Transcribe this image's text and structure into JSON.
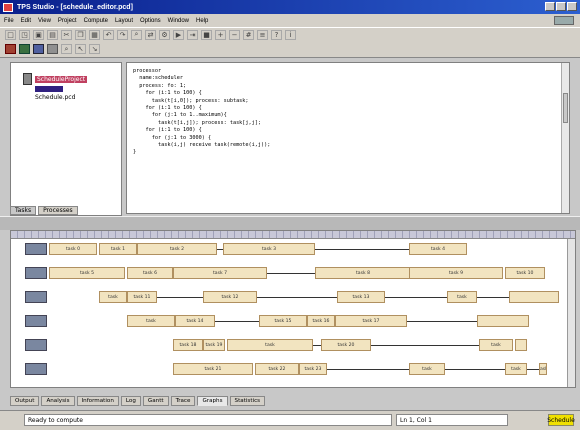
{
  "window": {
    "title": "TPS Studio - [schedule_editor.pcd]"
  },
  "menu": [
    "File",
    "Edit",
    "View",
    "Project",
    "Compute",
    "Layout",
    "Options",
    "Window",
    "Help"
  ],
  "toolbar1_icons": [
    "new-icon",
    "open-icon",
    "save-icon",
    "print-icon",
    "cut-icon",
    "copy-icon",
    "paste-icon",
    "undo-icon",
    "redo-icon",
    "find-icon",
    "replace-icon",
    "compile-icon",
    "run-icon",
    "step-icon",
    "stop-icon",
    "zoom-in-icon",
    "zoom-out-icon",
    "grid-icon",
    "settings-icon",
    "help-icon",
    "about-icon"
  ],
  "toolbar2_icons": [
    "process-icon",
    "channel-icon",
    "task-icon",
    "graph-icon",
    "zoom-icon",
    "pointer-icon",
    "link-icon"
  ],
  "tree": {
    "root_label": "ScheduleProject",
    "child_label": "",
    "child2_label": "Schedule.pcd"
  },
  "left_tabs": [
    "Tasks",
    "Processes"
  ],
  "code_lines": [
    "processor",
    "  name:scheduler",
    "  process: fo: 1;",
    "    for (i:1 to 100) {",
    "      task(t[i,0]); process: subtask;",
    "",
    "    for (i:1 to 100) {",
    "      for (j:1 to 1..maximum){",
    "        task(t[i,j]); process: task[j,j];",
    "",
    "    for (i:1 to 100) {",
    "      for (j:1 to 3000) {",
    "        task(i,j) receive task(remote(i,j));",
    "}"
  ],
  "gantt": {
    "rows": 6,
    "tasks": [
      [
        "task 0",
        "task 1",
        "task 2",
        "task 3",
        "task 4"
      ],
      [
        "task 5",
        "task 6",
        "task 7",
        "task 8",
        "task 9",
        "task 10"
      ],
      [
        "task",
        "task 11",
        "task 12",
        "task 13",
        "task"
      ],
      [
        "task",
        "task 14",
        "task 15",
        "task 16",
        "task 17"
      ],
      [
        "task 18",
        "task 19",
        "task",
        "task 20",
        "task"
      ],
      [
        "task 21",
        "task 22",
        "task 23",
        "task",
        "task",
        "task"
      ]
    ]
  },
  "bottom_tabs": [
    "Output",
    "Analysis",
    "Information",
    "Log",
    "Gantt",
    "Trace",
    "Graphs",
    "Statistics"
  ],
  "status": {
    "message": "Ready to compute",
    "position": "Ln 1, Col 1",
    "mode": "Schedule"
  }
}
